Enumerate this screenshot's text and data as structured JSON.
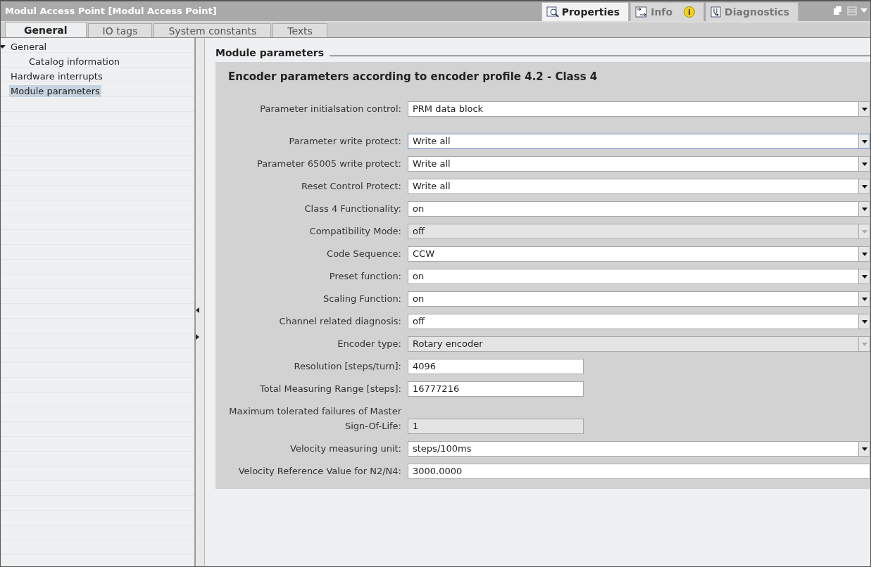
{
  "window": {
    "title": "Modul Access Point [Modul Access Point]"
  },
  "inspector_tabs": [
    {
      "label": "Properties",
      "selected": true,
      "kind": "properties"
    },
    {
      "label": "Info",
      "selected": false,
      "kind": "info",
      "badge": "i"
    },
    {
      "label": "Diagnostics",
      "selected": false,
      "kind": "diagnostics"
    }
  ],
  "tabs": [
    {
      "label": "General",
      "selected": true
    },
    {
      "label": "IO tags",
      "selected": false
    },
    {
      "label": "System constants",
      "selected": false
    },
    {
      "label": "Texts",
      "selected": false
    }
  ],
  "sidebar": {
    "items": [
      {
        "label": "General",
        "selected": false,
        "expanded": true,
        "children": [
          {
            "label": "Catalog information",
            "selected": false
          }
        ]
      },
      {
        "label": "Hardware interrupts",
        "selected": false
      },
      {
        "label": "Module parameters",
        "selected": true
      }
    ]
  },
  "section": {
    "title": "Module parameters"
  },
  "panel": {
    "title": "Encoder parameters according to encoder profile 4.2 - Class 4",
    "groups": [
      [
        {
          "label": "Parameter initialsation control:",
          "kind": "dropdown",
          "value": "PRM data block",
          "disabled": false,
          "focused": false
        }
      ],
      [
        {
          "label": "Parameter write protect:",
          "kind": "dropdown",
          "value": "Write all",
          "disabled": false,
          "focused": true
        },
        {
          "label": "Parameter 65005 write protect:",
          "kind": "dropdown",
          "value": "Write all",
          "disabled": false,
          "focused": false
        },
        {
          "label": "Reset Control Protect:",
          "kind": "dropdown",
          "value": "Write all",
          "disabled": false,
          "focused": false
        },
        {
          "label": "Class 4 Functionality:",
          "kind": "dropdown",
          "value": "on",
          "disabled": false,
          "focused": false
        },
        {
          "label": "Compatibility Mode:",
          "kind": "dropdown",
          "value": "off",
          "disabled": true,
          "focused": false
        },
        {
          "label": "Code Sequence:",
          "kind": "dropdown",
          "value": "CCW",
          "disabled": false,
          "focused": false
        },
        {
          "label": "Preset function:",
          "kind": "dropdown",
          "value": "on",
          "disabled": false,
          "focused": false
        },
        {
          "label": "Scaling Function:",
          "kind": "dropdown",
          "value": "on",
          "disabled": false,
          "focused": false
        },
        {
          "label": "Channel related diagnosis:",
          "kind": "dropdown",
          "value": "off",
          "disabled": false,
          "focused": false
        },
        {
          "label": "Encoder type:",
          "kind": "dropdown",
          "value": "Rotary encoder",
          "disabled": true,
          "focused": false
        },
        {
          "label": "Resolution [steps/turn]:",
          "kind": "text",
          "value": "4096",
          "disabled": false,
          "focused": false
        },
        {
          "label": "Total Measuring Range [steps]:",
          "kind": "text",
          "value": "16777216",
          "disabled": false,
          "focused": false
        },
        {
          "label": "Maximum tolerated failures of Master Sign-Of-Life:",
          "kind": "text",
          "value": "1",
          "disabled": true,
          "focused": false
        },
        {
          "label": "Velocity measuring unit:",
          "kind": "dropdown",
          "value": "steps/100ms",
          "disabled": false,
          "focused": false
        },
        {
          "label": "Velocity Reference Value for N2/N4:",
          "kind": "wide",
          "value": "3000.0000",
          "disabled": false,
          "focused": false
        }
      ]
    ]
  }
}
